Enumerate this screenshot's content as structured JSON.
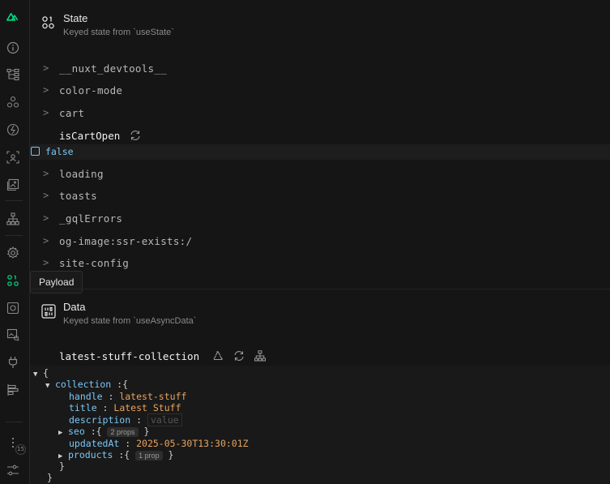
{
  "tooltip": "Payload",
  "sidebar": {
    "badge": "15",
    "icons": [
      "nuxt-logo-icon",
      "info-icon",
      "component-tree-icon",
      "components-icon",
      "state-flash-icon",
      "inspect-icon",
      "images-icon",
      "hierarchy-icon",
      "settings-icon",
      "payload-icon",
      "screenshot-icon",
      "assets-icon",
      "plug-icon",
      "timeline-icon",
      "more-icon",
      "sliders-icon"
    ]
  },
  "state": {
    "title": "State",
    "subtitle": "Keyed state from `useState`",
    "items": [
      "__nuxt_devtools__",
      "color-mode",
      "cart"
    ],
    "open_key": "isCartOpen",
    "open_value": "false",
    "items_after": [
      "loading",
      "toasts",
      "_gqlErrors",
      "og-image:ssr-exists:/",
      "site-config"
    ]
  },
  "data": {
    "title": "Data",
    "subtitle": "Keyed state from `useAsyncData`",
    "open_key": "latest-stuff-collection",
    "json": {
      "root_open": "{",
      "collection_key": "collection",
      "handle_key": "handle",
      "handle_val": "latest-stuff",
      "title_key": "title",
      "title_val": "Latest Stuff",
      "description_key": "description",
      "description_placeholder": "value",
      "seo_key": "seo",
      "seo_badge": "2 props",
      "updated_key": "updatedAt",
      "updated_val": "2025-05-30T13:30:01Z",
      "products_key": "products",
      "products_badge": "1 prop",
      "close_inner": "}",
      "close_root": "}"
    }
  }
}
